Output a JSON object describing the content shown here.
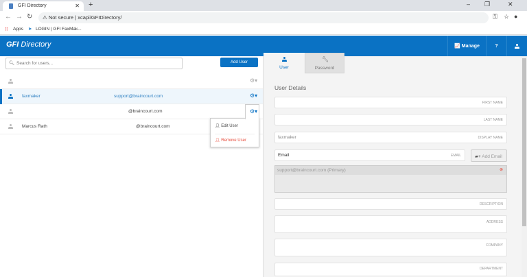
{
  "browser": {
    "tab_title": "GFI Directory",
    "security": "Not secure",
    "url": "xcapi/GFIDirectory/",
    "bookmarks": [
      "Apps",
      "LOGIN | GFI FaxMak..."
    ]
  },
  "header": {
    "logo_bold": "GFI",
    "logo_text": "Directory",
    "manage": "Manage",
    "help": "?"
  },
  "left": {
    "search_placeholder": "Search for users...",
    "add_user": "Add User",
    "users": [
      {
        "name": "",
        "email": ""
      },
      {
        "name": "faxmaker",
        "email": "support@braincourt.com"
      },
      {
        "name": "",
        "email": "@braincourt.com"
      },
      {
        "name": "Marcus Rath",
        "email": "@braincourt.com"
      }
    ],
    "menu": {
      "edit": "Edit User",
      "remove": "Remove User"
    }
  },
  "right": {
    "tabs": [
      "User",
      "Password"
    ],
    "section": "User Details",
    "fields": {
      "first_name": "FIRST NAME",
      "last_name": "LAST NAME",
      "display_name": "DISPLAY NAME",
      "display_value": "faxmaker",
      "email_placeholder": "Email",
      "email_label": "EMAIL",
      "add_email": "Add Email",
      "primary_email": "support@braincourt.com (Primary)",
      "description": "DESCRIPTION",
      "address": "ADDRESS",
      "company": "COMPANY",
      "department": "DEPARTMENT"
    }
  },
  "colors": {
    "brand": "#0a72c4",
    "danger": "#e74c3c"
  }
}
